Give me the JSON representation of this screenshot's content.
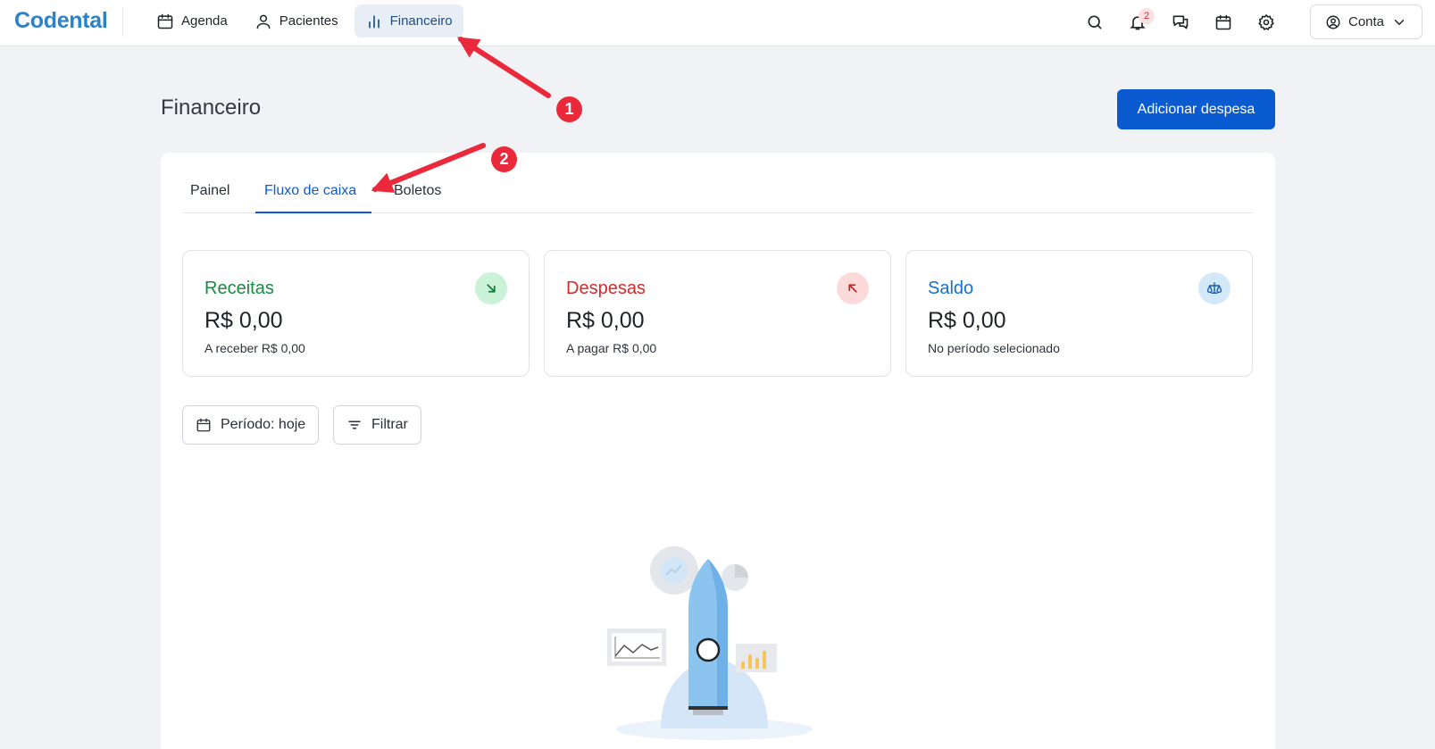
{
  "app": {
    "logo": "Codental"
  },
  "nav": [
    {
      "label": "Agenda",
      "icon": "calendar-icon"
    },
    {
      "label": "Pacientes",
      "icon": "user-icon"
    },
    {
      "label": "Financeiro",
      "icon": "bar-chart-icon",
      "active": true
    }
  ],
  "header_icons": [
    "search-icon",
    "bell-icon",
    "chat-icon",
    "calendar-icon",
    "gear-icon"
  ],
  "notifications": {
    "count": "2"
  },
  "account": {
    "label": "Conta"
  },
  "page": {
    "title": "Financeiro",
    "add_expense": "Adicionar despesa"
  },
  "tabs": [
    {
      "label": "Painel"
    },
    {
      "label": "Fluxo de caixa",
      "active": true
    },
    {
      "label": "Boletos"
    }
  ],
  "stats": [
    {
      "label": "Receitas",
      "amount": "R$ 0,00",
      "sub": "A receber R$ 0,00",
      "color": "#1a8a43",
      "bubble": "#c9f2d6",
      "icon": "arrow-down-right-icon"
    },
    {
      "label": "Despesas",
      "amount": "R$ 0,00",
      "sub": "A pagar R$ 0,00",
      "color": "#d42a2a",
      "bubble": "#fcdada",
      "icon": "arrow-up-left-icon"
    },
    {
      "label": "Saldo",
      "amount": "R$ 0,00",
      "sub": "No período selecionado",
      "color": "#1471c9",
      "bubble": "#d3e8f9",
      "icon": "scale-icon"
    }
  ],
  "filters": {
    "period": "Período: hoje",
    "filter": "Filtrar"
  },
  "annotations": [
    "1",
    "2"
  ],
  "colors": {
    "primary": "#0b5bd0",
    "annotation": "#ea2a3a",
    "logo": "#2a83c9"
  }
}
